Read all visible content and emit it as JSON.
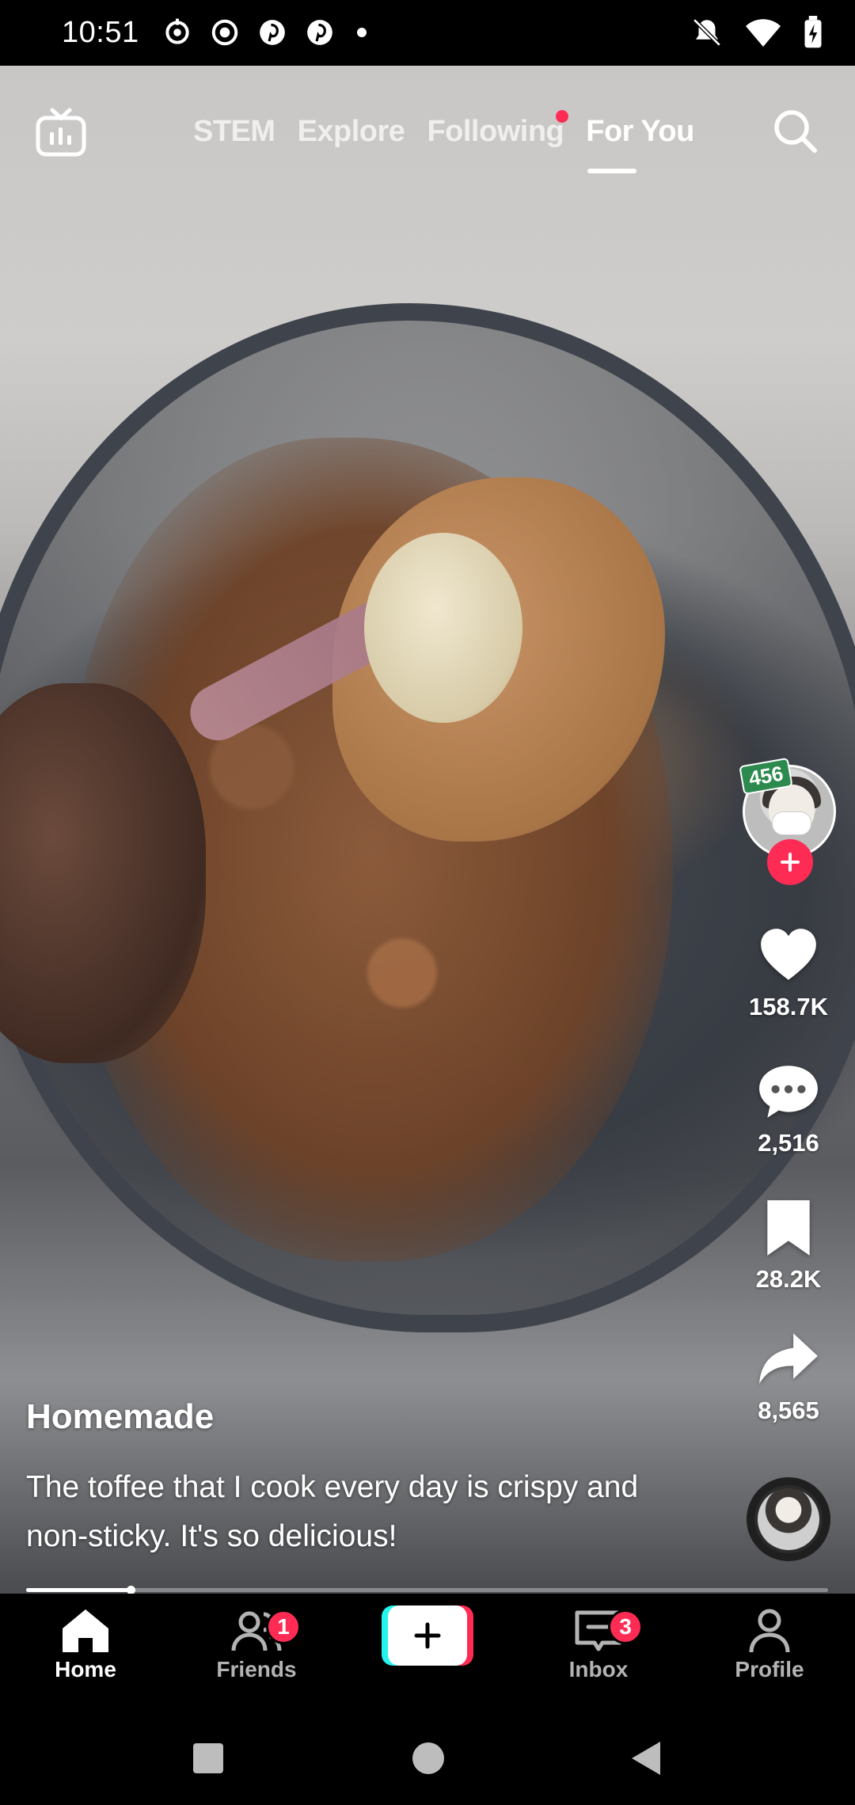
{
  "status_bar": {
    "time": "10:51",
    "left_icons": [
      "sync-icon",
      "record-icon",
      "pinterest-icon",
      "pinterest-icon",
      "dot-icon"
    ],
    "right_icons": [
      "bell-off-icon",
      "wifi-icon",
      "battery-charging-icon"
    ]
  },
  "top_nav": {
    "live_icon": "tv-icon",
    "tabs": [
      {
        "label": "STEM",
        "active": false
      },
      {
        "label": "Explore",
        "active": false
      },
      {
        "label": "Following",
        "active": false,
        "has_dot": true
      },
      {
        "label": "For You",
        "active": true
      }
    ],
    "search_icon": "search-icon"
  },
  "creator": {
    "badge": "456"
  },
  "actions": {
    "likes": "158.7K",
    "comments": "2,516",
    "saves": "28.2K",
    "shares": "8,565"
  },
  "post": {
    "author": "Homemade",
    "caption": "The toffee that I cook every day is crispy and non-sticky. It's so delicious!",
    "progress": 0.13
  },
  "tab_bar": {
    "home": {
      "label": "Home",
      "active": true
    },
    "friends": {
      "label": "Friends",
      "badge": "1"
    },
    "create": {
      "label": "+"
    },
    "inbox": {
      "label": "Inbox",
      "badge": "3"
    },
    "profile": {
      "label": "Profile"
    }
  },
  "colors": {
    "accent": "#fe2c55",
    "cyan": "#25f4ee",
    "badge_green": "#2d8a4e"
  }
}
